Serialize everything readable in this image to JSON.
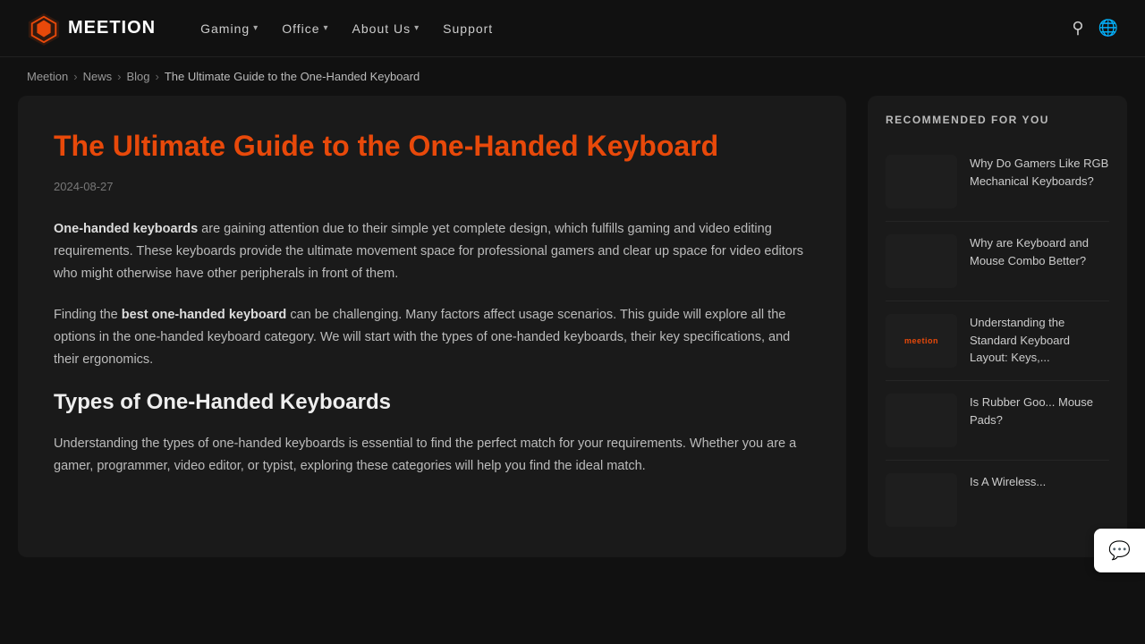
{
  "header": {
    "logo_text": "MEETION",
    "nav_items": [
      {
        "label": "Gaming",
        "has_dropdown": true
      },
      {
        "label": "Office",
        "has_dropdown": true
      },
      {
        "label": "About Us",
        "has_dropdown": true
      },
      {
        "label": "Support",
        "has_dropdown": false
      }
    ]
  },
  "breadcrumb": {
    "items": [
      "Meetion",
      "News",
      "Blog",
      "The Ultimate Guide to the One-Handed Keyboard"
    ]
  },
  "article": {
    "title": "The Ultimate Guide to the One-Handed Keyboard",
    "date": "2024-08-27",
    "paragraphs": [
      {
        "text_start_bold": "One-handed keyboards",
        "text_rest": " are gaining attention due to their simple yet complete design, which fulfills gaming and video editing requirements. These keyboards provide the ultimate movement space for professional gamers and clear up space for video editors who might otherwise have other peripherals in front of them."
      },
      {
        "text_start": "Finding the ",
        "text_bold": "best one-handed keyboard",
        "text_rest": " can be challenging. Many factors affect usage scenarios. This guide will explore all the options in the one-handed keyboard category. We will start with the types of one-handed keyboards, their key specifications, and their ergonomics."
      }
    ],
    "section_title": "Types of One-Handed Keyboards",
    "section_para": "Understanding the types of one-handed keyboards is essential to find the perfect match for your requirements. Whether you are a gamer, programmer, video editor, or typist, exploring these categories will help you find the ideal match."
  },
  "sidebar": {
    "section_title": "RECOMMENDED FOR YOU",
    "items": [
      {
        "title": "Why Do Gamers Like RGB Mechanical Keyboards?"
      },
      {
        "title": "Why are Keyboard and Mouse Combo Better?"
      },
      {
        "title": "Understanding the Standard Keyboard Layout: Keys,..."
      },
      {
        "title": "Is Rubber Goo... Mouse Pads?"
      },
      {
        "title": "Is A Wireless..."
      }
    ]
  },
  "chat_widget": {
    "tooltip": "Chat"
  }
}
